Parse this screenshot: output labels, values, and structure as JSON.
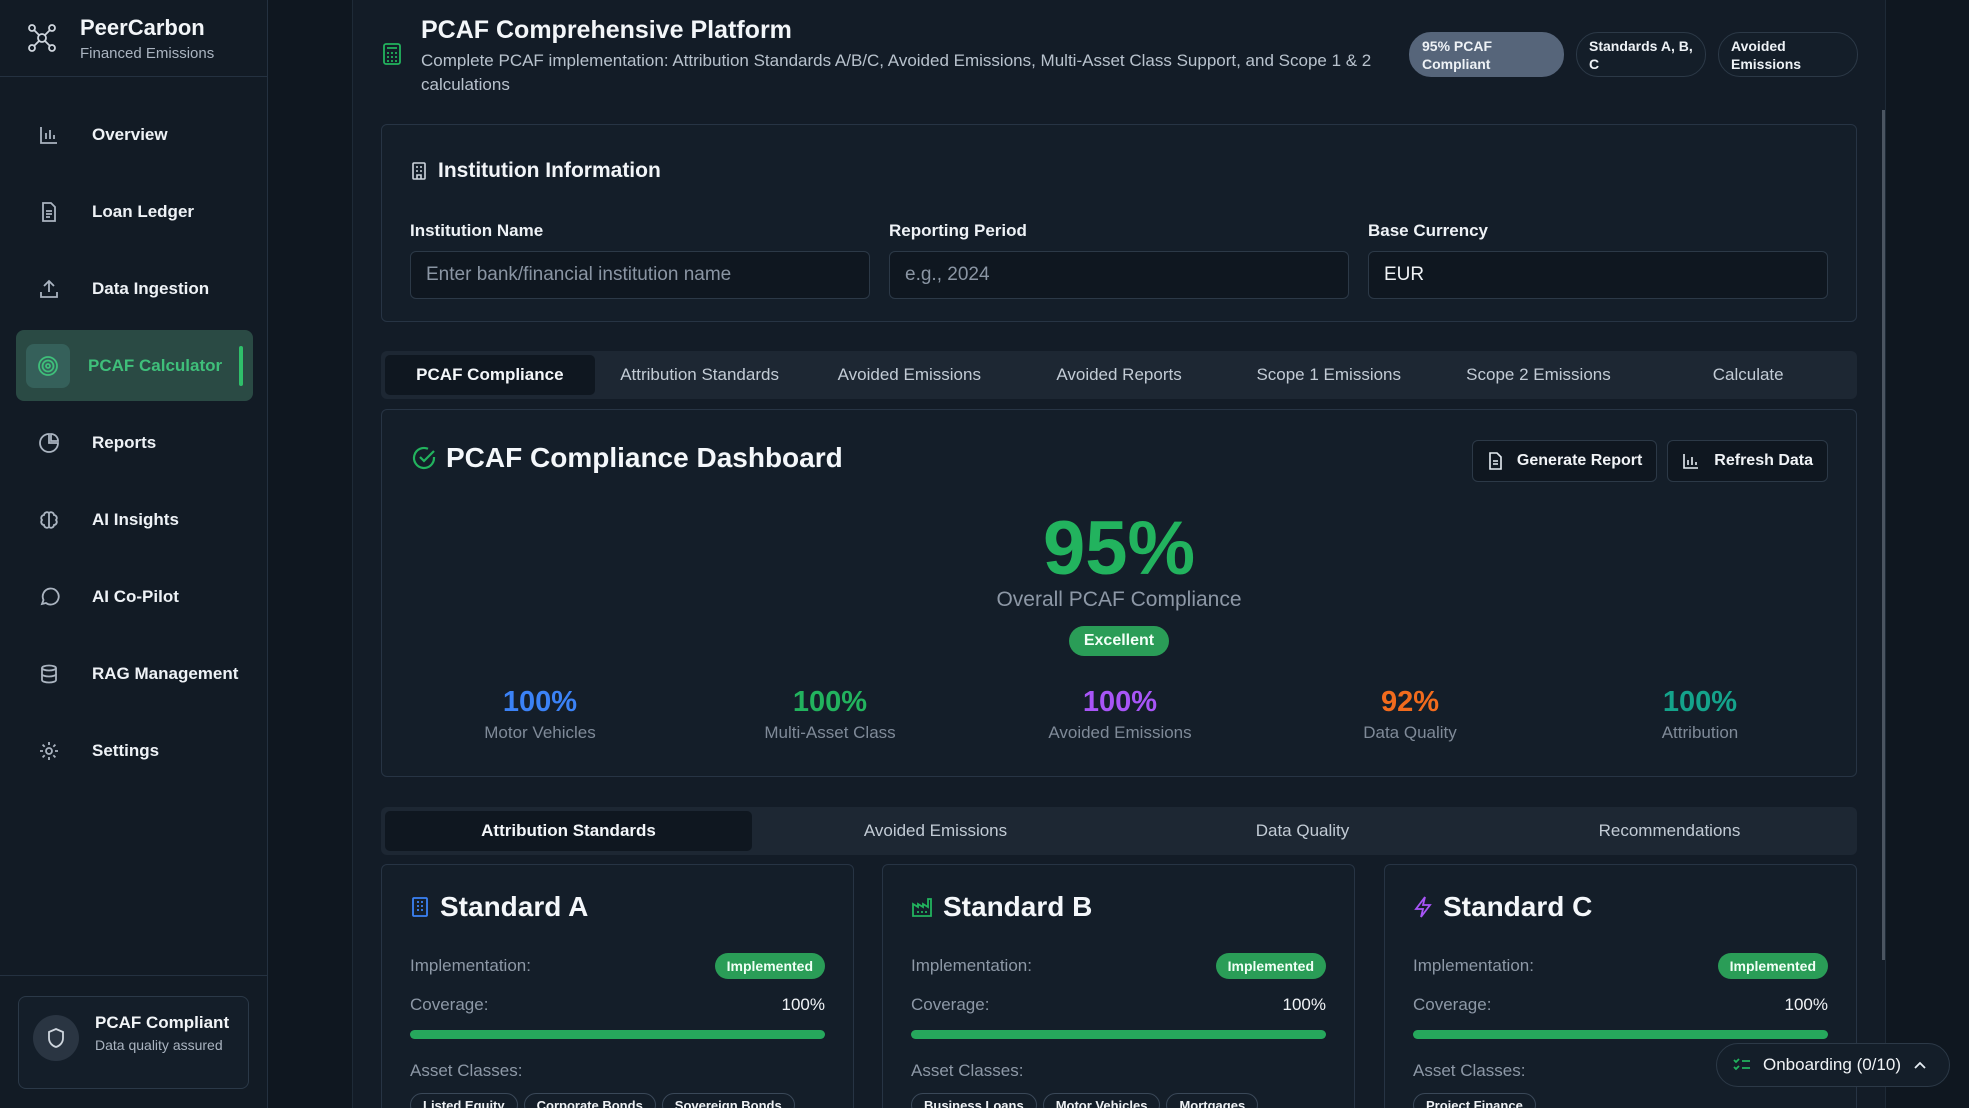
{
  "brand": {
    "title": "PeerCarbon",
    "subtitle": "Financed Emissions"
  },
  "sidebar": {
    "items": [
      {
        "label": "Overview",
        "icon": "bar-chart-icon"
      },
      {
        "label": "Loan Ledger",
        "icon": "document-icon"
      },
      {
        "label": "Data Ingestion",
        "icon": "upload-icon"
      },
      {
        "label": "PCAF Calculator",
        "icon": "target-icon",
        "active": true
      },
      {
        "label": "Reports",
        "icon": "pie-chart-icon"
      },
      {
        "label": "AI Insights",
        "icon": "brain-icon"
      },
      {
        "label": "AI Co-Pilot",
        "icon": "chat-icon"
      },
      {
        "label": "RAG Management",
        "icon": "database-icon"
      },
      {
        "label": "Settings",
        "icon": "gear-icon"
      }
    ],
    "footer": {
      "title": "PCAF Compliant",
      "subtitle": "Data quality assured"
    }
  },
  "header": {
    "title": "PCAF Comprehensive Platform",
    "description": "Complete PCAF implementation: Attribution Standards A/B/C, Avoided Emissions, Multi-Asset Class Support, and Scope 1 & 2 calculations",
    "badges": [
      "95% PCAF Compliant",
      "Standards A, B, C",
      "Avoided Emissions"
    ]
  },
  "institution": {
    "title": "Institution Information",
    "fields": [
      {
        "label": "Institution Name",
        "placeholder": "Enter bank/financial institution name",
        "value": ""
      },
      {
        "label": "Reporting Period",
        "placeholder": "e.g., 2024",
        "value": ""
      },
      {
        "label": "Base Currency",
        "placeholder": "",
        "value": "EUR"
      }
    ]
  },
  "main_tabs": [
    "PCAF Compliance",
    "Attribution Standards",
    "Avoided Emissions",
    "Avoided Reports",
    "Scope 1 Emissions",
    "Scope 2 Emissions",
    "Calculate"
  ],
  "dashboard": {
    "title": "PCAF Compliance Dashboard",
    "buttons": {
      "generate": "Generate Report",
      "refresh": "Refresh Data"
    },
    "overall_pct": "95%",
    "overall_label": "Overall PCAF Compliance",
    "rating": "Excellent",
    "metrics": [
      {
        "value": "100%",
        "label": "Motor Vehicles",
        "color": "#3b82f6"
      },
      {
        "value": "100%",
        "label": "Multi-Asset Class",
        "color": "#22b35e"
      },
      {
        "value": "100%",
        "label": "Avoided Emissions",
        "color": "#a855f7"
      },
      {
        "value": "92%",
        "label": "Data Quality",
        "color": "#f26b1d"
      },
      {
        "value": "100%",
        "label": "Attribution",
        "color": "#14a38b"
      }
    ]
  },
  "sub_tabs": [
    "Attribution Standards",
    "Avoided Emissions",
    "Data Quality",
    "Recommendations"
  ],
  "standards": [
    {
      "title": "Standard A",
      "icon": "building-icon",
      "icon_color": "#3b82f6",
      "impl_label": "Implementation:",
      "status": "Implemented",
      "cov_label": "Coverage:",
      "coverage": "100%",
      "coverage_fraction": 1.0,
      "asset_label": "Asset Classes:",
      "chips": [
        "Listed Equity",
        "Corporate Bonds",
        "Sovereign Bonds"
      ]
    },
    {
      "title": "Standard B",
      "icon": "factory-icon",
      "icon_color": "#22b35e",
      "impl_label": "Implementation:",
      "status": "Implemented",
      "cov_label": "Coverage:",
      "coverage": "100%",
      "coverage_fraction": 1.0,
      "asset_label": "Asset Classes:",
      "chips": [
        "Business Loans",
        "Motor Vehicles",
        "Mortgages"
      ]
    },
    {
      "title": "Standard C",
      "icon": "lightning-icon",
      "icon_color": "#a855f7",
      "impl_label": "Implementation:",
      "status": "Implemented",
      "cov_label": "Coverage:",
      "coverage": "100%",
      "coverage_fraction": 1.0,
      "asset_label": "Asset Classes:",
      "chips": [
        "Project Finance"
      ]
    }
  ],
  "onboarding": {
    "label": "Onboarding (0/10)"
  }
}
